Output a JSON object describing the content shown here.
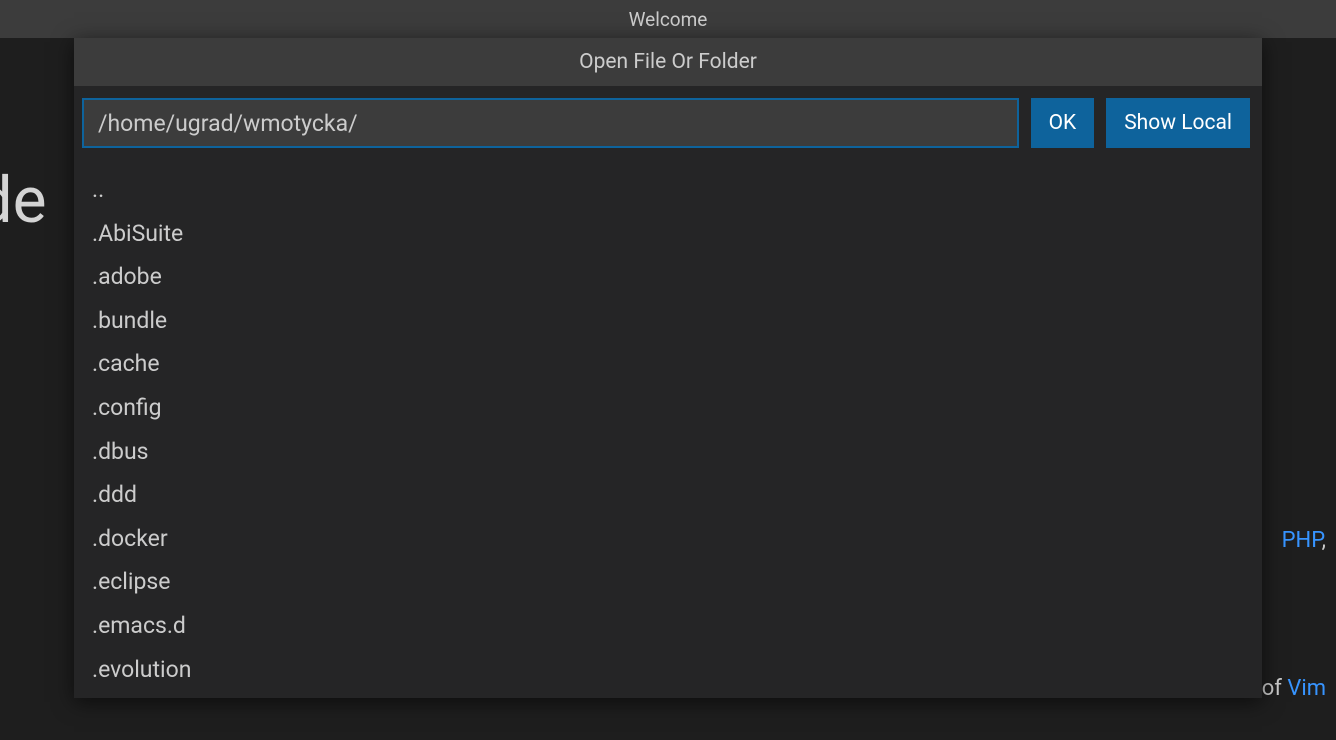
{
  "titleBar": {
    "title": "Welcome"
  },
  "background": {
    "largeText": "ode",
    "phpSnippet": "PHP",
    "phpSnippetSuffix": ",",
    "vimSnippetPrefix": "of ",
    "vimSnippet": "Vim"
  },
  "dialog": {
    "title": "Open File Or Folder",
    "pathValue": "/home/ugrad/wmotycka/",
    "okLabel": "OK",
    "showLocalLabel": "Show Local",
    "items": [
      "..",
      ".AbiSuite",
      ".adobe",
      ".bundle",
      ".cache",
      ".config",
      ".dbus",
      ".ddd",
      ".docker",
      ".eclipse",
      ".emacs.d",
      ".evolution"
    ]
  }
}
